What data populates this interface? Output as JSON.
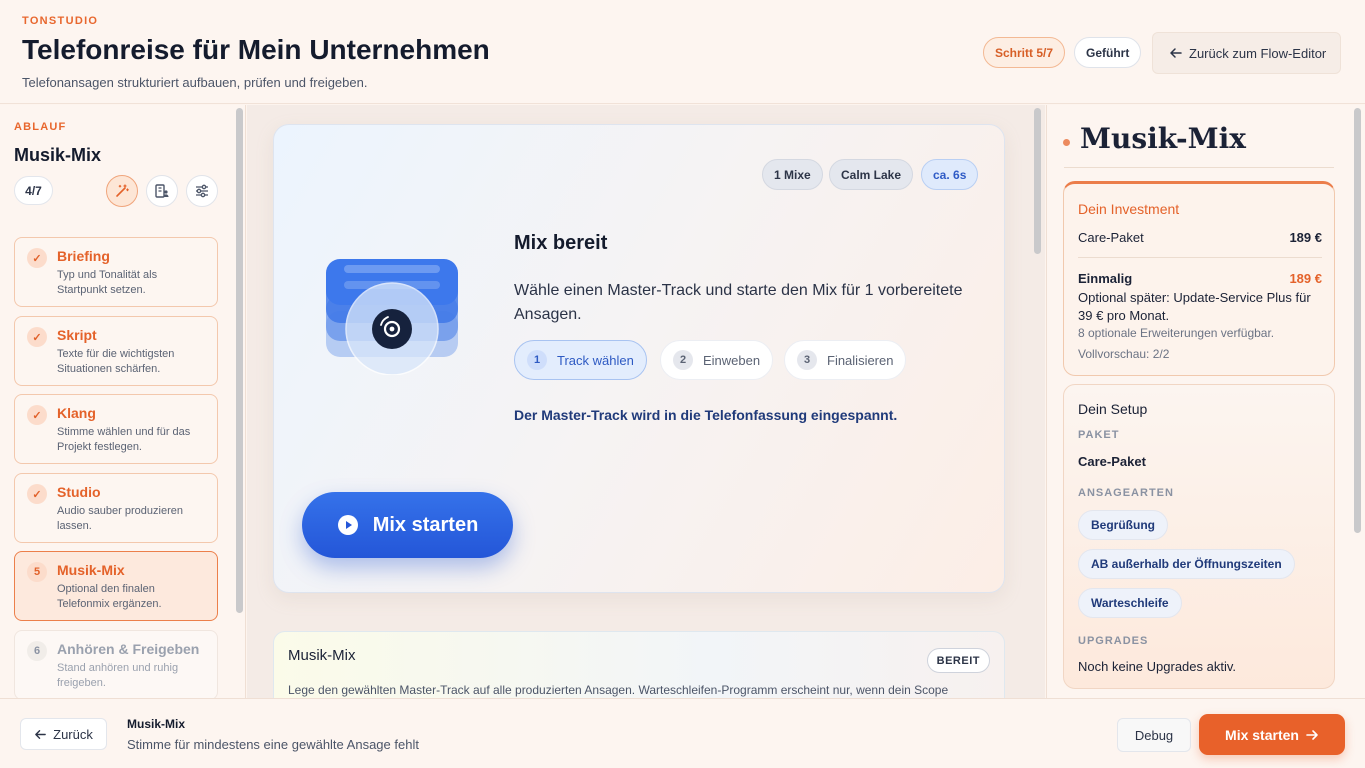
{
  "header": {
    "eyebrow": "TONSTUDIO",
    "title": "Telefonreise für Mein Unternehmen",
    "subtitle": "Telefonansagen strukturiert aufbauen, prüfen und freigeben.",
    "step_chip": "Schritt 5/7",
    "mode_chip": "Geführt",
    "back_button": "Zurück zum Flow-Editor"
  },
  "sidebar": {
    "eyebrow": "ABLAUF",
    "title": "Musik-Mix",
    "counter": "4/7",
    "tools": [
      "magic-wand-icon",
      "building-user-icon",
      "sliders-icon"
    ],
    "steps": [
      {
        "marker": "✓",
        "name": "Briefing",
        "desc": "Typ und Tonalität als Startpunkt setzen.",
        "state": "done"
      },
      {
        "marker": "✓",
        "name": "Skript",
        "desc": "Texte für die wichtigsten Situationen schärfen.",
        "state": "done"
      },
      {
        "marker": "✓",
        "name": "Klang",
        "desc": "Stimme wählen und für das Projekt festlegen.",
        "state": "done"
      },
      {
        "marker": "✓",
        "name": "Studio",
        "desc": "Audio sauber produzieren lassen.",
        "state": "done"
      },
      {
        "marker": "5",
        "name": "Musik-Mix",
        "desc": "Optional den finalen Telefonmix ergänzen.",
        "state": "current"
      },
      {
        "marker": "6",
        "name": "Anhören & Freigeben",
        "desc": "Stand anhören und ruhig freigeben.",
        "state": "pending"
      }
    ]
  },
  "main": {
    "chips": [
      "1 Mixe",
      "Calm Lake",
      "ca. 6s"
    ],
    "heading": "Mix bereit",
    "text": "Wähle einen Master-Track und starte den Mix für 1 vorbereitete Ansagen.",
    "pills": [
      {
        "num": "1",
        "label": "Track wählen"
      },
      {
        "num": "2",
        "label": "Einweben"
      },
      {
        "num": "3",
        "label": "Finalisieren"
      }
    ],
    "note": "Der Master-Track wird in die Telefonfassung eingespannt.",
    "start_button": "Mix starten",
    "info": {
      "title": "Musik-Mix",
      "badge": "BEREIT",
      "text": "Lege den gewählten Master-Track auf alle produzierten Ansagen. Warteschleifen-Programm erscheint nur, wenn dein Scope"
    }
  },
  "right": {
    "title": "Musik-Mix",
    "investment": {
      "title": "Dein Investment",
      "row1_label": "Care-Paket",
      "row1_value": "189 €",
      "row2_label": "Einmalig",
      "row2_value": "189 €",
      "optional": "Optional später: Update-Service Plus für 39 € pro Monat.",
      "extensions": "8 optionale Erweiterungen verfügbar.",
      "preview": "Vollvorschau: 2/2"
    },
    "setup": {
      "title": "Dein Setup",
      "package_label": "PAKET",
      "package_value": "Care-Paket",
      "types_label": "ANSAGEARTEN",
      "types": [
        "Begrüßung",
        "AB außerhalb der Öffnungszeiten",
        "Warteschleife"
      ],
      "upgrades_label": "UPGRADES",
      "upgrades_value": "Noch keine Upgrades aktiv."
    }
  },
  "footer": {
    "back": "Zurück",
    "title": "Musik-Mix",
    "subtitle": "Stimme für mindestens eine gewählte Ansage fehlt",
    "debug": "Debug",
    "primary": "Mix starten"
  },
  "colors": {
    "accent": "#e8612a",
    "primary_blue": "#2456d8",
    "background": "#fdf5f0"
  }
}
